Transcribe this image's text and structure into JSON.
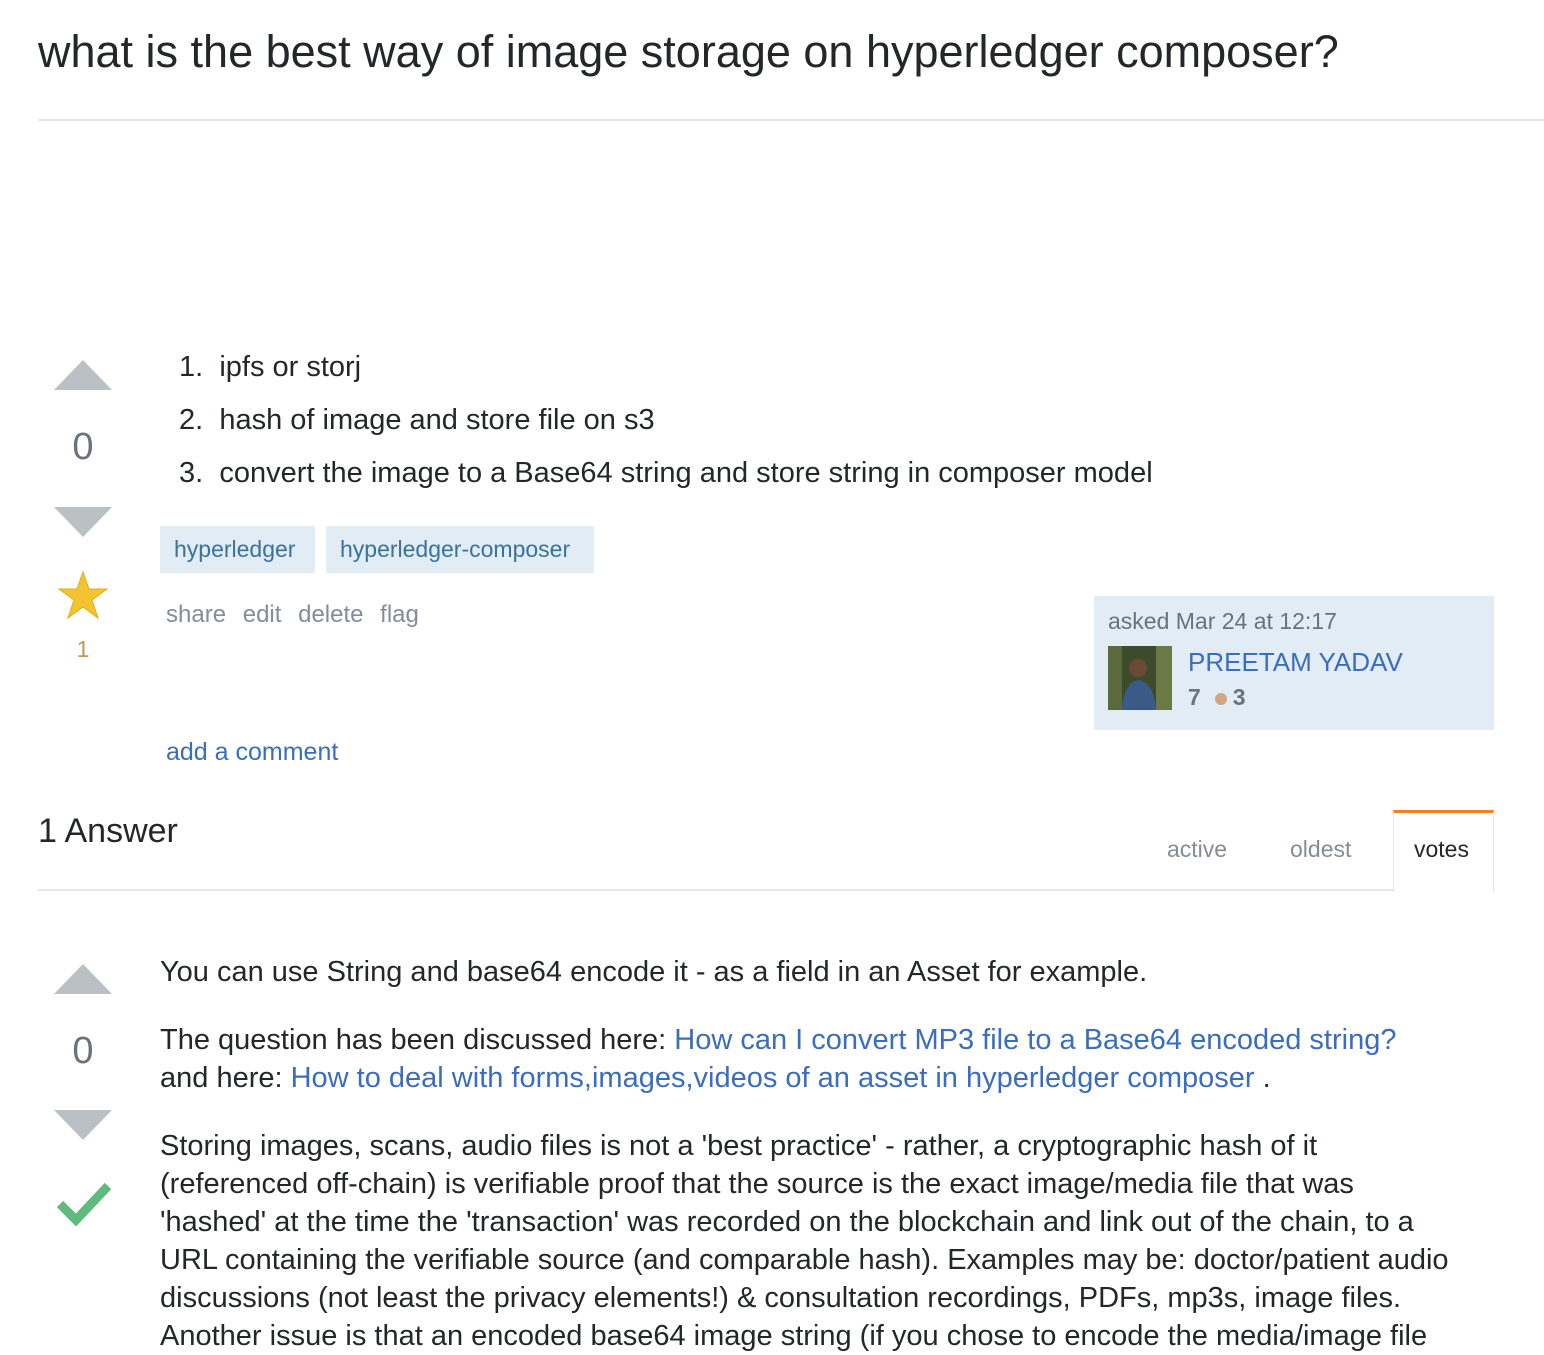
{
  "question": {
    "title": "what is the best way of image storage on hyperledger composer?",
    "vote_count": "0",
    "favorite_count": "1",
    "list_items": [
      {
        "num": "1.",
        "text": "ipfs or storj"
      },
      {
        "num": "2.",
        "text": "hash of image and store file on s3"
      },
      {
        "num": "3.",
        "text": "convert the image to a Base64 string and store string in composer model"
      }
    ],
    "tags": [
      "hyperledger",
      "hyperledger-composer"
    ],
    "menu": [
      "share",
      "edit",
      "delete",
      "flag"
    ],
    "asked_label": "asked Mar 24 at 12:17",
    "user_name": "PREETAM YADAV",
    "reputation": "7",
    "bronze_badges": "3",
    "add_comment": "add a comment"
  },
  "answers_header": {
    "title": "1 Answer",
    "tabs": [
      "active",
      "oldest",
      "votes"
    ],
    "active_tab": "votes"
  },
  "answer": {
    "vote_count": "0",
    "accepted": true,
    "p1": "You can use String and base64 encode it - as a field in an Asset for example.",
    "p2_prefix": "The question has been discussed here: ",
    "p2_link1": "How can I convert MP3 file to a Base64 encoded string?",
    "p2_mid": "and here: ",
    "p2_link2": "How to deal with forms,images,videos of an asset in hyperledger composer",
    "p2_suffix": " .",
    "p3_lines": [
      "Storing images, scans, audio files is not a 'best practice' - rather, a cryptographic hash of it",
      "(referenced off-chain) is verifiable proof that the source is the exact image/media file that was",
      "'hashed' at the time the 'transaction' was recorded on the blockchain and link out of the chain, to a",
      "URL containing the verifiable source (and comparable hash). Examples may be: doctor/patient audio",
      "discussions (not least the privacy elements!) & consultation recordings, PDFs, mp3s, image files.",
      "Another issue is that an encoded base64 image string (if you chose to encode the media/image file"
    ]
  },
  "colors": {
    "link": "#3a6dbd",
    "tag_bg": "#e1ecf4",
    "tag_text": "#39739d",
    "star": "#f4c430",
    "check": "#5fba7d",
    "tab_accent": "#f48024"
  }
}
